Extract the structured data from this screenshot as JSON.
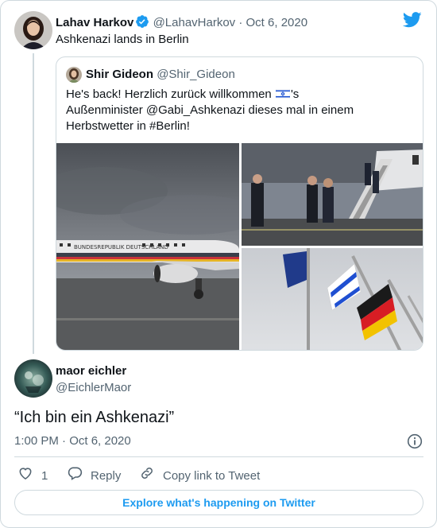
{
  "tweet": {
    "author_name": "Lahav Harkov",
    "author_handle": "@LahavHarkov",
    "separator": "·",
    "date": "Oct 6, 2020",
    "text": "Ashkenazi lands in Berlin"
  },
  "quoted": {
    "author_name": "Shir Gideon",
    "author_handle": "@Shir_Gideon",
    "line1_before_flag": "He's back! Herzlich zurück willkommen ",
    "line1_after_flag": "'s",
    "line2": "Außenminister @Gabi_Ashkenazi dieses mal in einem",
    "line3": "Herbstwetter in #Berlin!",
    "airplane_text": "BUNDESREPUBLIK   DEUTSCHLAND"
  },
  "reply": {
    "author_name": "maor eichler",
    "author_handle": "@EichlerMaor",
    "text": "“Ich bin ein Ashkenazi”",
    "timestamp": "1:00 PM · Oct 6, 2020"
  },
  "actions": {
    "like_count": "1",
    "reply_label": "Reply",
    "copy_label": "Copy link to Tweet"
  },
  "explore_label": "Explore what's happening on Twitter",
  "icons": {
    "verified": "verified-badge-icon",
    "brand": "twitter-bird-icon",
    "info": "info-icon",
    "like": "heart-icon",
    "reply": "reply-bubble-icon",
    "copy": "link-icon"
  },
  "colors": {
    "accent": "#1d9bf0",
    "muted": "#536471",
    "border": "#cfd9de",
    "text": "#0f1419"
  }
}
